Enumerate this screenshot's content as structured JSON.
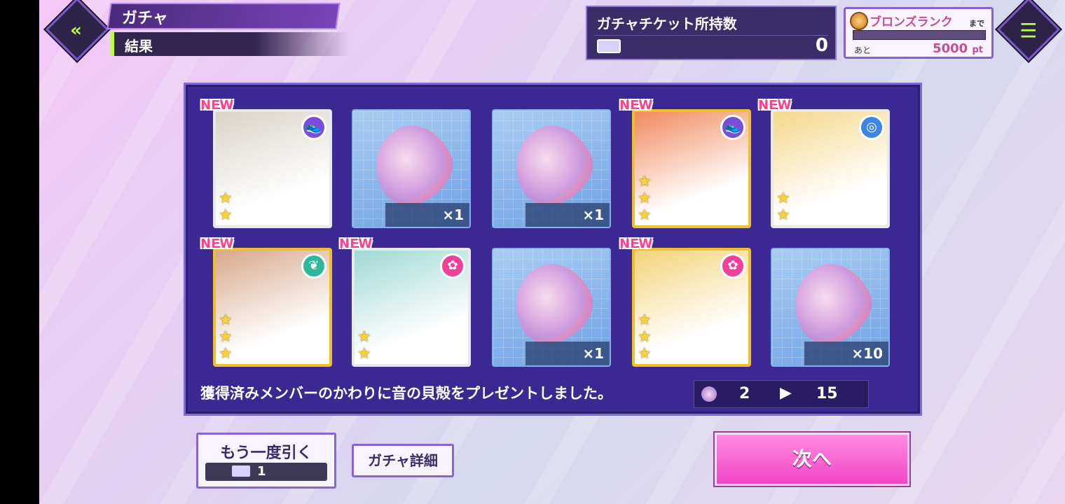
{
  "header": {
    "title": "ガチャ",
    "subtitle": "結果",
    "back_icon": "back-arrow-icon",
    "menu_icon": "list-menu-icon"
  },
  "ticket": {
    "label": "ガチャチケット所持数",
    "count": "0"
  },
  "rank": {
    "label": "ブロンズランク",
    "suffix": "まで",
    "remaining_label": "あと",
    "points": "5000",
    "unit": "pt"
  },
  "results": {
    "row1": [
      {
        "type": "member",
        "new": "NEW",
        "attr_icon": "shoe-icon",
        "attr_color": "#7b4ed8",
        "stars": "★★",
        "gold": false,
        "art_color": "#d9d3c8"
      },
      {
        "type": "shell",
        "qty": "×1"
      },
      {
        "type": "shell",
        "qty": "×1"
      },
      {
        "type": "member",
        "new": "NEW",
        "attr_icon": "shoe-icon",
        "attr_color": "#7b4ed8",
        "stars": "★★★",
        "gold": true,
        "art_color": "#f08a5d"
      },
      {
        "type": "member",
        "new": "NEW",
        "attr_icon": "swirl-icon",
        "attr_color": "#3c84e6",
        "stars": "★★",
        "gold": false,
        "art_color": "#f4d78a"
      }
    ],
    "row2": [
      {
        "type": "member",
        "new": "NEW",
        "attr_icon": "leaf-icon",
        "attr_color": "#2fb79a",
        "stars": "★★★",
        "gold": true,
        "art_color": "#d8a88a"
      },
      {
        "type": "member",
        "new": "NEW",
        "attr_icon": "bow-icon",
        "attr_color": "#f0419a",
        "stars": "★★",
        "gold": false,
        "art_color": "#9fd9d4"
      },
      {
        "type": "shell",
        "qty": "×1"
      },
      {
        "type": "member",
        "new": "NEW",
        "attr_icon": "bow-icon",
        "attr_color": "#f0419a",
        "stars": "★★★",
        "gold": true,
        "art_color": "#f3d37a"
      },
      {
        "type": "shell",
        "qty": "×10"
      }
    ]
  },
  "message": "獲得済みメンバーのかわりに音の貝殻をプレゼントしました。",
  "shell_count": {
    "from": "2",
    "to": "15"
  },
  "buttons": {
    "again": "もう一度引く",
    "again_cost": "1",
    "detail": "ガチャ詳細",
    "next": "次へ"
  }
}
